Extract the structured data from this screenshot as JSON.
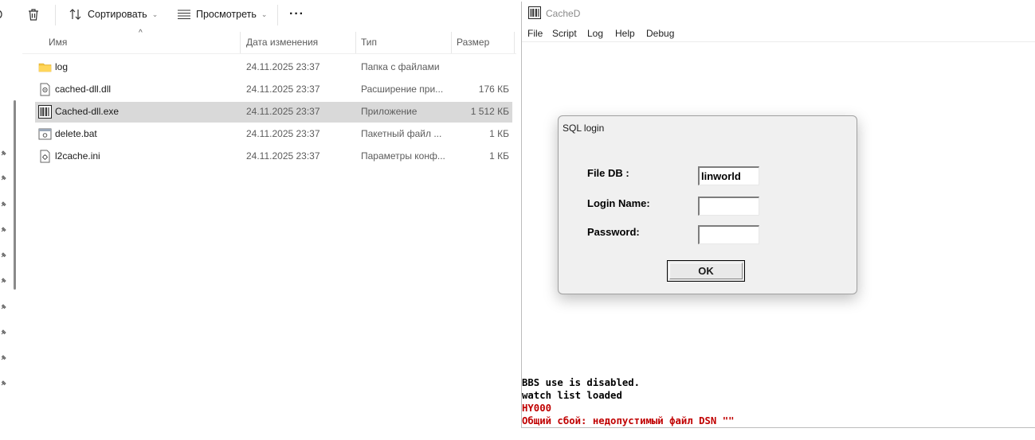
{
  "explorer": {
    "toolbar": {
      "sort_label": "Сортировать",
      "view_label": "Просмотреть",
      "more_label": "···"
    },
    "columns": {
      "name": "Имя",
      "date": "Дата изменения",
      "type": "Тип",
      "size": "Размер"
    },
    "files": [
      {
        "name": "log",
        "date": "24.11.2025 23:37",
        "type": "Папка с файлами",
        "size": "",
        "icon": "folder-icon"
      },
      {
        "name": "cached-dll.dll",
        "date": "24.11.2025 23:37",
        "type": "Расширение при...",
        "size": "176 КБ",
        "icon": "dll-file-icon"
      },
      {
        "name": "Cached-dll.exe",
        "date": "24.11.2025 23:37",
        "type": "Приложение",
        "size": "1 512 КБ",
        "icon": "exe-app-icon",
        "selected": true
      },
      {
        "name": "delete.bat",
        "date": "24.11.2025 23:37",
        "type": "Пакетный файл ...",
        "size": "1 КБ",
        "icon": "bat-file-icon"
      },
      {
        "name": "l2cache.ini",
        "date": "24.11.2025 23:37",
        "type": "Параметры конф...",
        "size": "1 КБ",
        "icon": "ini-file-icon"
      }
    ],
    "selected_row_color": "#d9d9d9"
  },
  "cached_window": {
    "title": "CacheD",
    "menu": [
      "File",
      "Script",
      "Log",
      "Help",
      "Debug"
    ],
    "log_lines": [
      {
        "text": "BBS use is disabled.",
        "color": "#000000"
      },
      {
        "text": "watch list loaded",
        "color": "#000000"
      },
      {
        "text": "HY000",
        "color": "#c00000"
      },
      {
        "text": "Общий сбой: недопустимый файл DSN \"\"",
        "color": "#c00000"
      }
    ]
  },
  "dialog": {
    "title": "SQL login",
    "file_db_label": "File DB :",
    "file_db_value": "linworld",
    "login_label": "Login Name:",
    "login_value": "",
    "password_label": "Password:",
    "password_value": "",
    "ok_label": "OK"
  }
}
